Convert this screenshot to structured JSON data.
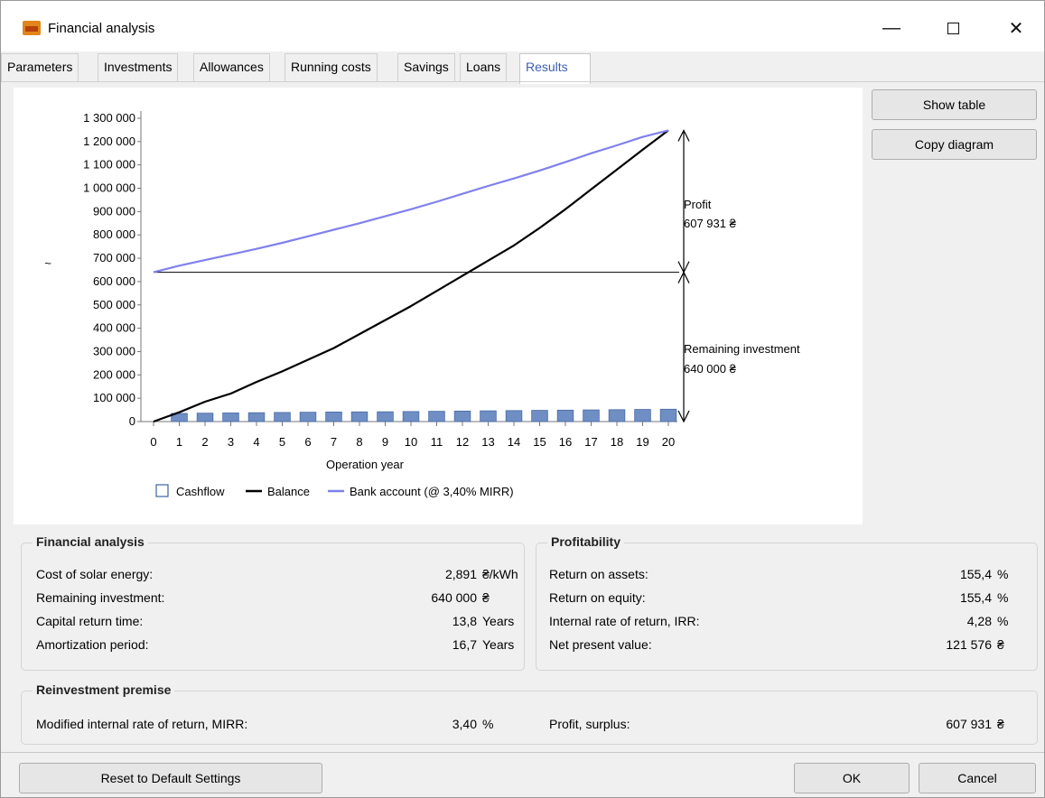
{
  "window": {
    "title": "Financial analysis",
    "minimize_glyph": "—",
    "close_glyph": "✕"
  },
  "tabs": [
    {
      "label": "Parameters"
    },
    {
      "label": "Investments"
    },
    {
      "label": "Allowances"
    },
    {
      "label": "Running costs"
    },
    {
      "label": "Savings"
    },
    {
      "label": "Loans"
    },
    {
      "label": "Results"
    }
  ],
  "active_tab": "Results",
  "side_buttons": {
    "show_table": "Show table",
    "copy_diagram": "Copy diagram"
  },
  "chart_data": {
    "type": "line",
    "xlabel": "Operation year",
    "ylabel": "~",
    "x": [
      0,
      1,
      2,
      3,
      4,
      5,
      6,
      7,
      8,
      9,
      10,
      11,
      12,
      13,
      14,
      15,
      16,
      17,
      18,
      19,
      20
    ],
    "xlim": [
      0,
      20
    ],
    "ylim": [
      0,
      1300000
    ],
    "yticks": [
      0,
      100000,
      200000,
      300000,
      400000,
      500000,
      600000,
      700000,
      800000,
      900000,
      1000000,
      1100000,
      1200000,
      1300000
    ],
    "ytick_labels": [
      "0",
      "100 000",
      "200 000",
      "300 000",
      "400 000",
      "500 000",
      "600 000",
      "700 000",
      "800 000",
      "900 000",
      "1 000 000",
      "1 100 000",
      "1 200 000",
      "1 300 000"
    ],
    "series": [
      {
        "name": "Cashflow",
        "kind": "bar",
        "color": "#6e8ec4",
        "values": [
          null,
          35000,
          36000,
          37000,
          38000,
          39000,
          40000,
          41000,
          41500,
          42000,
          43000,
          44000,
          45000,
          46000,
          47000,
          48000,
          49000,
          50000,
          51000,
          52000,
          53000
        ]
      },
      {
        "name": "Balance",
        "kind": "line",
        "color": "#000000",
        "values": [
          0,
          40000,
          85000,
          120000,
          170000,
          215000,
          265000,
          315000,
          375000,
          435000,
          495000,
          560000,
          625000,
          690000,
          755000,
          830000,
          910000,
          995000,
          1080000,
          1165000,
          1248000
        ]
      },
      {
        "name": "Bank account (@ 3,40% MIRR)",
        "kind": "line",
        "color": "#8080ee",
        "values": [
          640000,
          668000,
          692000,
          716000,
          740000,
          766000,
          794000,
          822000,
          850000,
          880000,
          910000,
          942000,
          976000,
          1010000,
          1042000,
          1076000,
          1112000,
          1150000,
          1184000,
          1220000,
          1248000
        ]
      }
    ],
    "reference_line": {
      "value": 640000,
      "color": "#000000"
    },
    "annotations": [
      {
        "label": "Profit",
        "value_text": "607 931 ₴"
      },
      {
        "label": "Remaining investment",
        "value_text": "640 000 ₴"
      }
    ],
    "legend_position": "bottom"
  },
  "financial_analysis": {
    "title": "Financial analysis",
    "rows": [
      {
        "label": "Cost of solar energy:",
        "value": "2,891",
        "unit": "₴/kWh"
      },
      {
        "label": "Remaining investment:",
        "value": "640 000",
        "unit": "₴"
      },
      {
        "label": "Capital return time:",
        "value": "13,8",
        "unit": "Years"
      },
      {
        "label": "Amortization period:",
        "value": "16,7",
        "unit": "Years"
      }
    ]
  },
  "profitability": {
    "title": "Profitability",
    "rows": [
      {
        "label": "Return on assets:",
        "value": "155,4",
        "unit": "%"
      },
      {
        "label": "Return on equity:",
        "value": "155,4",
        "unit": "%"
      },
      {
        "label": "Internal rate of return, IRR:",
        "value": "4,28",
        "unit": "%"
      },
      {
        "label": "Net present value:",
        "value": "121 576",
        "unit": "₴"
      }
    ]
  },
  "reinvestment": {
    "title": "Reinvestment premise",
    "mirr_label": "Modified internal rate of return, MIRR:",
    "mirr_value": "3,40",
    "mirr_unit": "%",
    "profit_label": "Profit, surplus:",
    "profit_value": "607 931",
    "profit_unit": "₴"
  },
  "footer": {
    "reset": "Reset to Default Settings",
    "ok": "OK",
    "cancel": "Cancel"
  }
}
